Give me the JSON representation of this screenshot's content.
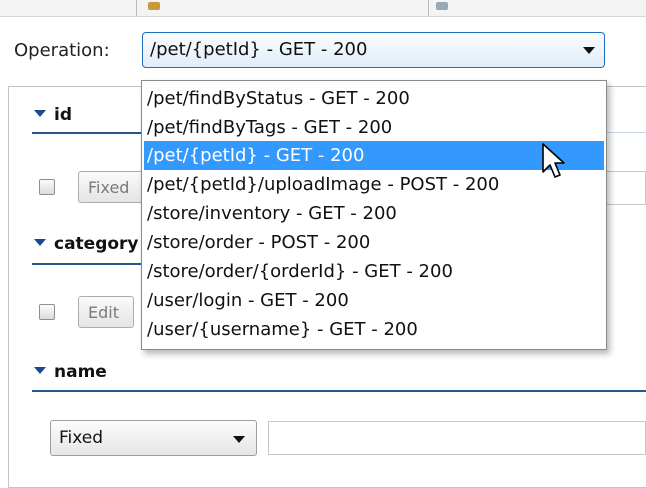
{
  "operation": {
    "label": "Operation:",
    "selected": "/pet/{petId} - GET - 200",
    "options": [
      "/pet/findByStatus - GET - 200",
      "/pet/findByTags - GET - 200",
      "/pet/{petId} - GET - 200",
      "/pet/{petId}/uploadImage - POST - 200",
      "/store/inventory - GET - 200",
      "/store/order - POST - 200",
      "/store/order/{orderId} - GET - 200",
      "/user/login - GET - 200",
      "/user/{username} - GET - 200"
    ],
    "highlighted_index": 2
  },
  "sections": {
    "id": {
      "title": "id",
      "mode_button": "Fixed"
    },
    "category": {
      "title": "category",
      "mode_button": "Edit"
    },
    "name": {
      "title": "name",
      "mode_select": "Fixed"
    }
  },
  "colors": {
    "accent": "#1f6ec0",
    "selection": "#3399ff",
    "section_rule": "#27568f"
  },
  "icons": [
    "dropdown-arrow-icon",
    "collapse-triangle-icon",
    "pointer-cursor-icon"
  ]
}
